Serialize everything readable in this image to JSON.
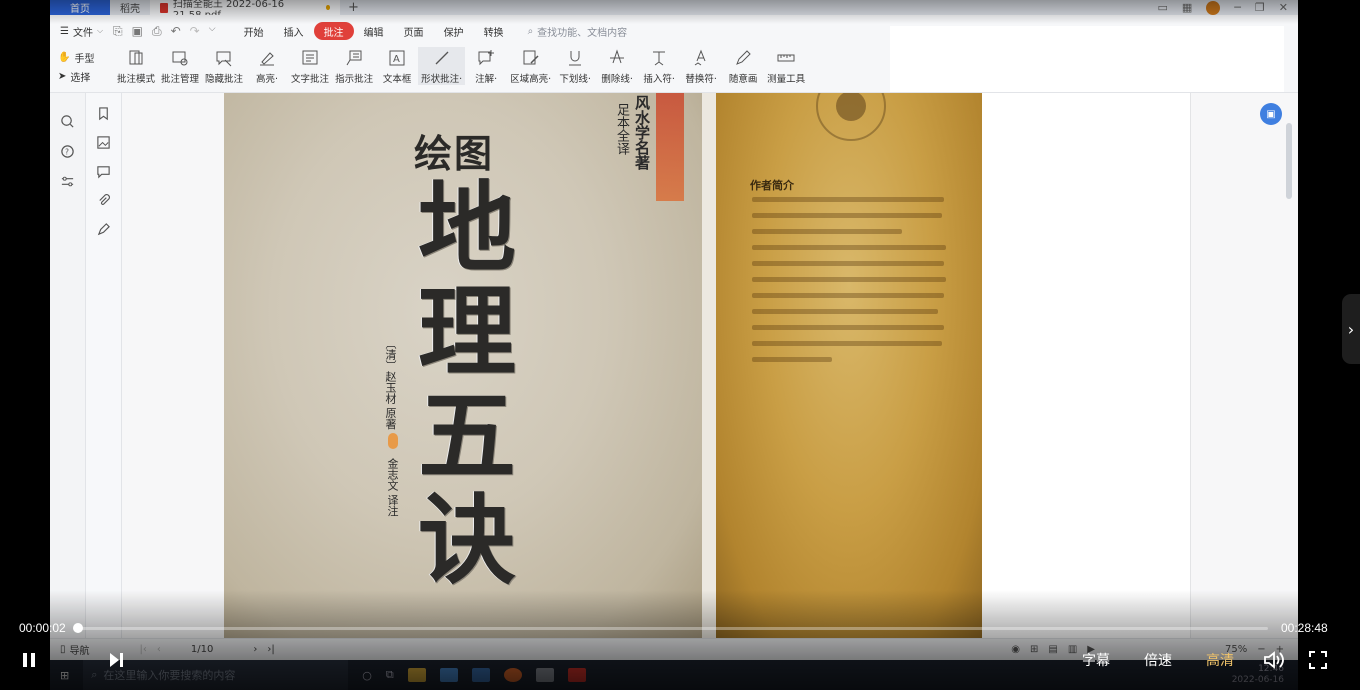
{
  "tabs": {
    "home": "首页",
    "second": "稻壳",
    "active": "扫描全能王 2022-06-16 21.58.pdf",
    "add": "+"
  },
  "menu": {
    "file": "文件",
    "items": [
      "开始",
      "插入",
      "批注",
      "编辑",
      "页面",
      "保护",
      "转换"
    ],
    "active_index": 2,
    "search_placeholder": "查找功能、文档内容"
  },
  "ribbon": {
    "hand": "手型",
    "select": "选择",
    "tools": [
      {
        "label": "批注模式",
        "icon": "annotation-mode-icon"
      },
      {
        "label": "批注管理",
        "icon": "annotation-manage-icon"
      },
      {
        "label": "隐藏批注",
        "icon": "hide-annotation-icon"
      },
      {
        "label": "高亮·",
        "icon": "highlight-icon"
      },
      {
        "label": "文字批注",
        "icon": "text-annotation-icon"
      },
      {
        "label": "指示批注",
        "icon": "pointer-annotation-icon"
      },
      {
        "label": "文本框",
        "icon": "textbox-icon"
      },
      {
        "label": "形状批注·",
        "icon": "shape-annotation-icon"
      },
      {
        "label": "注解·",
        "icon": "note-icon"
      },
      {
        "label": "区域高亮·",
        "icon": "area-highlight-icon"
      },
      {
        "label": "下划线·",
        "icon": "underline-icon"
      },
      {
        "label": "删除线·",
        "icon": "strikethrough-icon"
      },
      {
        "label": "插入符·",
        "icon": "insert-caret-icon"
      },
      {
        "label": "替换符·",
        "icon": "replace-caret-icon"
      },
      {
        "label": "随意画",
        "icon": "freehand-icon"
      },
      {
        "label": "测量工具",
        "icon": "ruler-icon"
      }
    ],
    "selected_index": 7
  },
  "cover": {
    "small_title": "绘图",
    "big_title": [
      "地",
      "理",
      "五",
      "诀"
    ],
    "series": "风水学名著",
    "series2": "足本全译",
    "author": "〔清〕赵玉材 原著",
    "translator": "金志文 译注"
  },
  "inner_page": {
    "heading": "作者简介"
  },
  "statusbar": {
    "nav": "导航",
    "page": "1/10",
    "zoom": "75%"
  },
  "taskbar": {
    "search_placeholder": "在这里输入你要搜索的内容",
    "clock_time": "12:46",
    "clock_date": "2022-06-16"
  },
  "player": {
    "current_time": "00:00:02",
    "total_time": "00:28:48",
    "progress": 0.0012,
    "subtitle_label": "字幕",
    "speed_label": "倍速",
    "quality_label": "高清",
    "colors": {
      "quality": "#f0c36a",
      "accent": "#e0403a",
      "brand_blue": "#2b63d9"
    }
  }
}
